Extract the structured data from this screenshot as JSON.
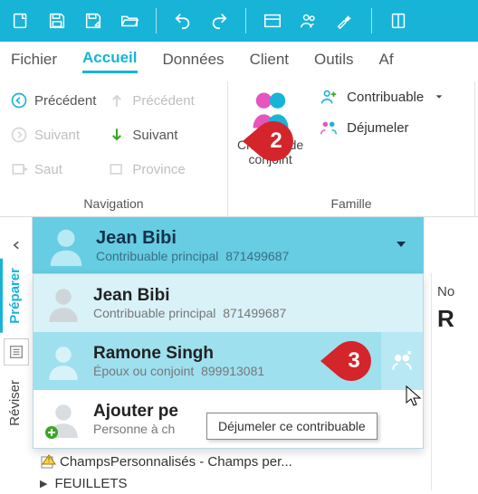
{
  "menu": {
    "items": [
      "Fichier",
      "Accueil",
      "Données",
      "Client",
      "Outils",
      "Af"
    ],
    "active_index": 1
  },
  "ribbon": {
    "navigation": {
      "label": "Navigation",
      "precedent": "Précédent",
      "precedent_disabled": "Précédent",
      "suivant_disabled": "Suivant",
      "suivant": "Suivant",
      "saut": "Saut",
      "province": "Province"
    },
    "famille": {
      "label": "Famille",
      "changer_l1": "Changer de",
      "changer_l2": "conjoint",
      "contribuable": "Contribuable",
      "dejumeler": "Déjumeler"
    }
  },
  "left_tabs": {
    "preparer": "Préparer",
    "reviser": "Réviser"
  },
  "current_person": {
    "name": "Jean Bibi",
    "role": "Contribuable principal",
    "id": "871499687"
  },
  "people": [
    {
      "name": "Jean Bibi",
      "role": "Contribuable principal",
      "id": "871499687"
    },
    {
      "name": "Ramone Singh",
      "role": "Époux ou conjoint",
      "id": "899913081"
    },
    {
      "name": "Ajouter pe",
      "role": "Personne à ch"
    }
  ],
  "tooltip": "Déjumeler ce contribuable",
  "right": {
    "nor": "No",
    "big": "R"
  },
  "tree": {
    "champs": "ChampsPersonnalisés - Champs per...",
    "feuillets": "FEUILLETS"
  },
  "markers": {
    "m2": "2",
    "m3": "3"
  }
}
